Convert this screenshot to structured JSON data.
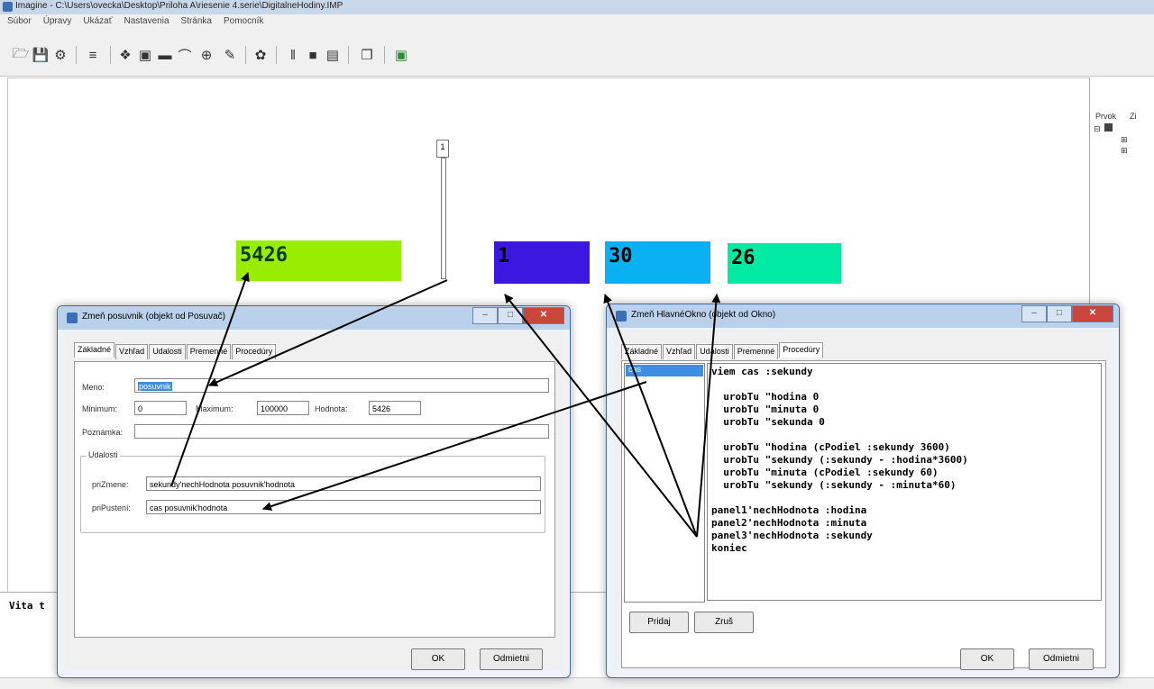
{
  "window": {
    "title": "Imagine - C:\\Users\\ovecka\\Desktop\\Priloha A\\riesenie 4.serie\\DigitalneHodiny.IMP"
  },
  "menu": [
    "Súbor",
    "Úpravy",
    "Ukázať",
    "Nastavenia",
    "Stránka",
    "Pomocník"
  ],
  "panels": {
    "slider_value": "5426",
    "hodina": "1",
    "minuta": "30",
    "sekunda": "26"
  },
  "colors": {
    "slider_panel": "#99ee00",
    "hodina_panel": "#3b18e0",
    "minuta_panel": "#09b0f2",
    "sekunda_panel": "#00eaa4"
  },
  "slider": {
    "thumb_label": "1"
  },
  "right_panel": {
    "col1": "Prvok",
    "col2": "Zi"
  },
  "command_line": {
    "text": "Vita t"
  },
  "dialog_left": {
    "title": "Zmeň posuvnik (objekt od Posuvač)",
    "tabs": [
      "Základné",
      "Vzhľad",
      "Udalosti",
      "Premenné",
      "Procedúry"
    ],
    "fields": {
      "meno_label": "Meno:",
      "meno_value": "posuvnik",
      "minimum_label": "Minimum:",
      "minimum_value": "0",
      "maximum_label": "Maximum:",
      "maximum_value": "100000",
      "hodnota_label": "Hodnota:",
      "hodnota_value": "5426",
      "poznamka_label": "Poznámka:",
      "poznamka_value": ""
    },
    "events": {
      "group_title": "Udalosti",
      "prizmene_label": "priZmene:",
      "prizmene_value": "sekundy'nechHodnota posuvnik'hodnota",
      "pripusteni_label": "priPustení:",
      "pripusteni_value": "cas posuvnik'hodnota"
    },
    "buttons": {
      "ok": "OK",
      "cancel": "Odmietni"
    }
  },
  "dialog_right": {
    "title": "Zmeň HlavnéOkno (objekt od Okno)",
    "tabs": [
      "Základné",
      "Vzhľad",
      "Udalosti",
      "Premenné",
      "Procedúry"
    ],
    "procedures": [
      "cas"
    ],
    "code": "viem cas :sekundy\n\n  urobTu \"hodina 0\n  urobTu \"minuta 0\n  urobTu \"sekunda 0\n\n  urobTu \"hodina (cPodiel :sekundy 3600)\n  urobTu \"sekundy (:sekundy - :hodina*3600)\n  urobTu \"minuta (cPodiel :sekundy 60)\n  urobTu \"sekundy (:sekundy - :minuta*60)\n\npanel1'nechHodnota :hodina\npanel2'nechHodnota :minuta\npanel3'nechHodnota :sekundy\nkoniec",
    "buttons": {
      "add": "Pridaj",
      "remove": "Zruš",
      "ok": "OK",
      "cancel": "Odmietni"
    }
  }
}
